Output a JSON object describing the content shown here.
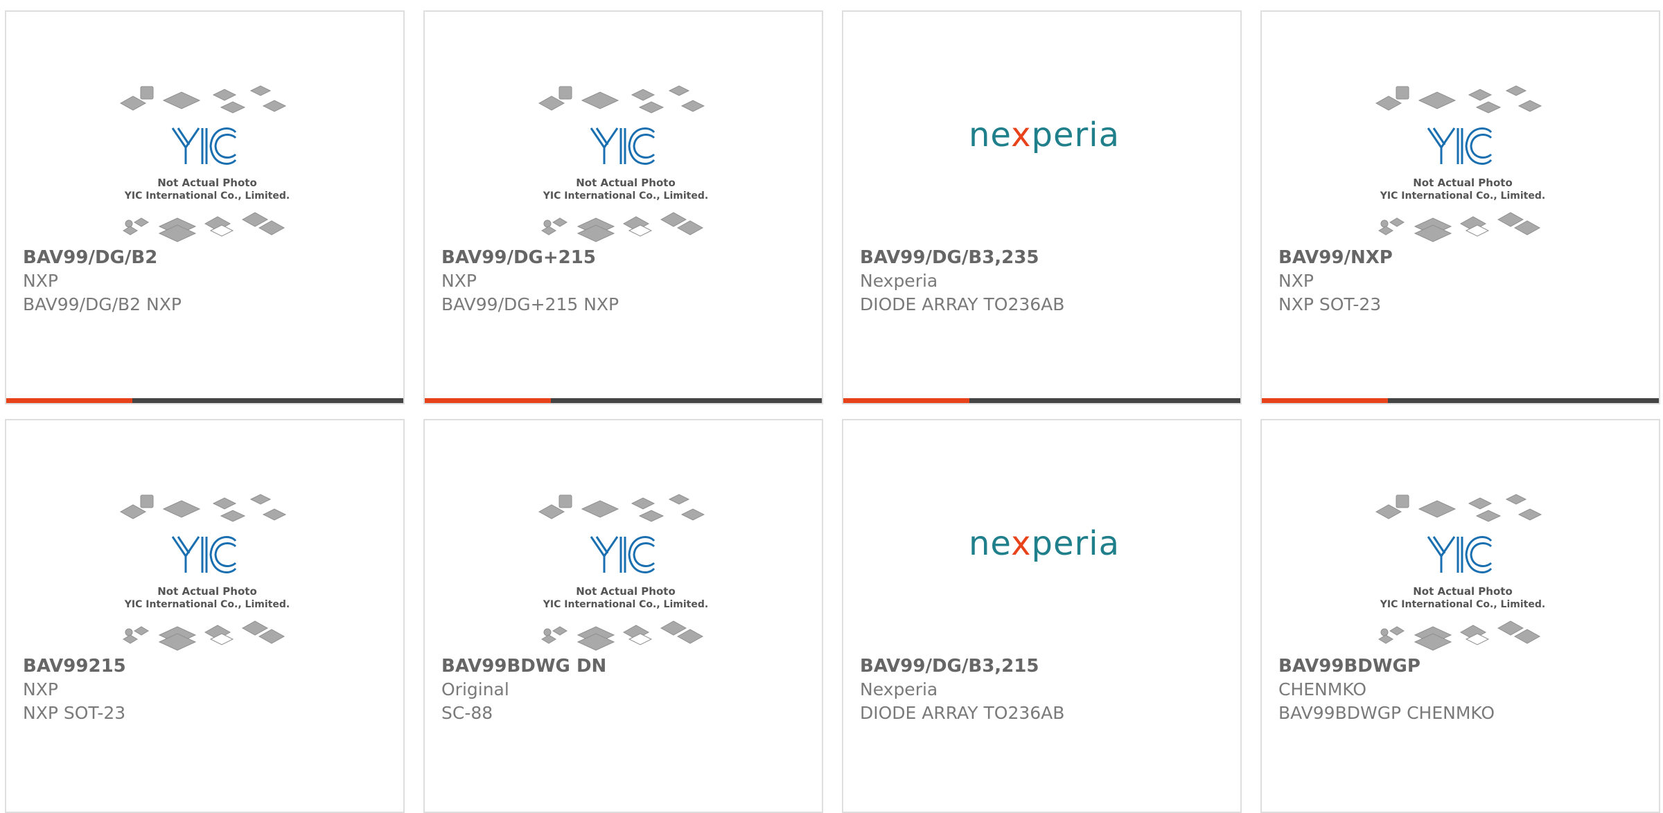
{
  "products": [
    {
      "part_number": "BAV99/DG/B2",
      "manufacturer": "NXP",
      "description": "BAV99/DG/B2 NXP",
      "image": "yic-placeholder"
    },
    {
      "part_number": "BAV99/DG+215",
      "manufacturer": "NXP",
      "description": "BAV99/DG+215 NXP",
      "image": "yic-placeholder"
    },
    {
      "part_number": "BAV99/DG/B3,235",
      "manufacturer": "Nexperia",
      "description": "DIODE ARRAY TO236AB",
      "image": "nexperia-logo"
    },
    {
      "part_number": "BAV99/NXP",
      "manufacturer": "NXP",
      "description": "NXP SOT-23",
      "image": "yic-placeholder"
    },
    {
      "part_number": "BAV99215",
      "manufacturer": "NXP",
      "description": "NXP SOT-23",
      "image": "yic-placeholder"
    },
    {
      "part_number": "BAV99BDWG DN",
      "manufacturer": "Original",
      "description": "SC-88",
      "image": "yic-placeholder"
    },
    {
      "part_number": "BAV99/DG/B3,215",
      "manufacturer": "Nexperia",
      "description": "DIODE ARRAY TO236AB",
      "image": "nexperia-logo"
    },
    {
      "part_number": "BAV99BDWGP",
      "manufacturer": "CHENMKO",
      "description": "BAV99BDWGP CHENMKO",
      "image": "yic-placeholder"
    }
  ],
  "placeholder": {
    "line1": "Not Actual Photo",
    "line2": "YIC International Co., Limited.",
    "logo_text": "YIC"
  },
  "nexperia": {
    "pre": "ne",
    "x": "x",
    "post": "peria"
  },
  "colors": {
    "accent": "#e8421a",
    "bar": "#444444",
    "yic_blue": "#1a6fb0",
    "nexperia_teal": "#1f7f8a",
    "text": "#666666",
    "border": "#dedede"
  }
}
